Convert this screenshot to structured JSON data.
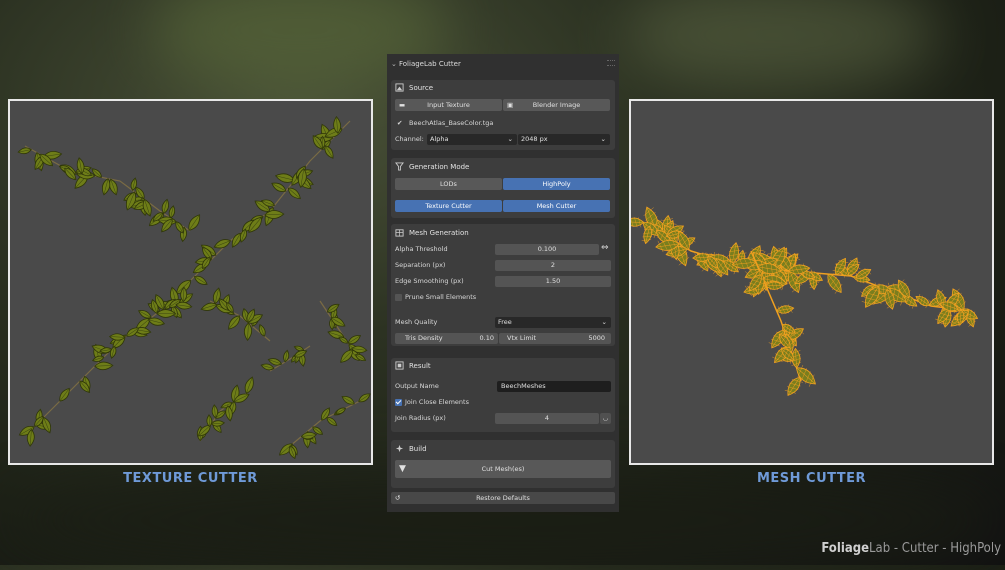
{
  "captions": {
    "left": "TEXTURE CUTTER",
    "right": "MESH CUTTER"
  },
  "watermark": {
    "brand_bold": "Foliage",
    "brand_rest": "Lab",
    "suffix": " - Cutter - HighPoly"
  },
  "panel": {
    "title": "FoliageLab Cutter",
    "source": {
      "header": "Source",
      "input_texture_label": "Input Texture",
      "blender_image_label": "Blender Image",
      "file_name": "BeechAtlas_BaseColor.tga",
      "channel_label": "Channel:",
      "channel_value": "Alpha",
      "resolution_value": "2048 px"
    },
    "generation_mode": {
      "header": "Generation Mode",
      "lods_label": "LODs",
      "highpoly_label": "HighPoly",
      "texture_cutter_label": "Texture Cutter",
      "mesh_cutter_label": "Mesh Cutter"
    },
    "mesh_generation": {
      "header": "Mesh Generation",
      "alpha_threshold_label": "Alpha Threshold",
      "alpha_threshold_value": "0.100",
      "separation_label": "Separation (px)",
      "separation_value": "2",
      "edge_smoothing_label": "Edge Smoothing (px)",
      "edge_smoothing_value": "1.50",
      "prune_label": "Prune Small Elements",
      "prune_checked": false,
      "mesh_quality_label": "Mesh Quality",
      "mesh_quality_value": "Free",
      "tris_density_label": "Tris Density",
      "tris_density_value": "0.10",
      "vtx_limit_label": "Vtx Limit",
      "vtx_limit_value": "5000"
    },
    "result": {
      "header": "Result",
      "output_name_label": "Output Name",
      "output_name_value": "BeechMeshes",
      "join_label": "Join Close Elements",
      "join_checked": true,
      "join_radius_label": "Join Radius (px)",
      "join_radius_value": "4"
    },
    "build": {
      "header": "Build",
      "cut_label": "Cut Mesh(es)"
    },
    "restore_label": "Restore Defaults"
  },
  "colors": {
    "accent": "#4772b3",
    "caption": "#6f9ad8",
    "panel_bg": "#303030",
    "leaf": "#6b7a1a",
    "wire": "#e89a1c"
  }
}
